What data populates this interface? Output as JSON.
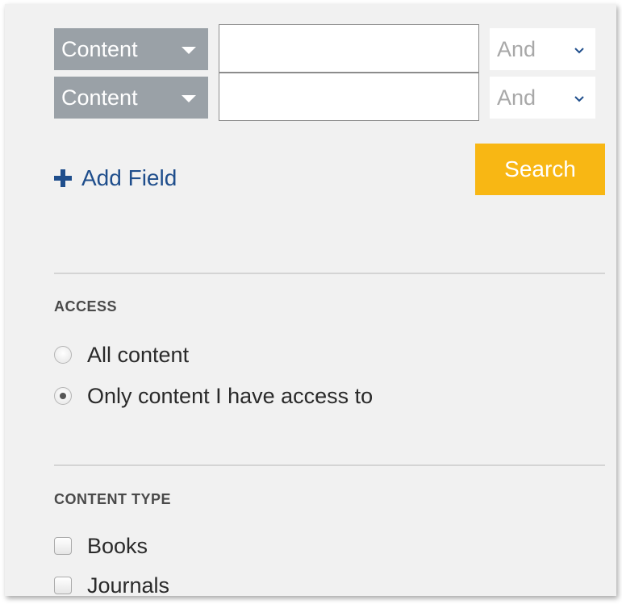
{
  "search_rows": [
    {
      "field": "Content",
      "value": "",
      "placeholder": "",
      "operator": "And"
    },
    {
      "field": "Content",
      "value": "",
      "placeholder": "",
      "operator": "And"
    }
  ],
  "add_field_label": "Add Field",
  "search_label": "Search",
  "access": {
    "heading": "ACCESS",
    "options": [
      {
        "label": "All content",
        "selected": false
      },
      {
        "label": "Only content I have access to",
        "selected": true
      }
    ]
  },
  "content_type": {
    "heading": "CONTENT TYPE",
    "options": [
      {
        "label": "Books",
        "checked": false
      },
      {
        "label": "Journals",
        "checked": false
      }
    ]
  },
  "colors": {
    "select_bg": "#9aa1a7",
    "search_button": "#f8b714",
    "link_blue": "#1f4e8c",
    "panel_bg": "#f1f1f1"
  },
  "icons": {
    "field_caret": "caret-down-icon",
    "operator_chevron": "chevron-down-icon",
    "add": "plus-icon"
  }
}
